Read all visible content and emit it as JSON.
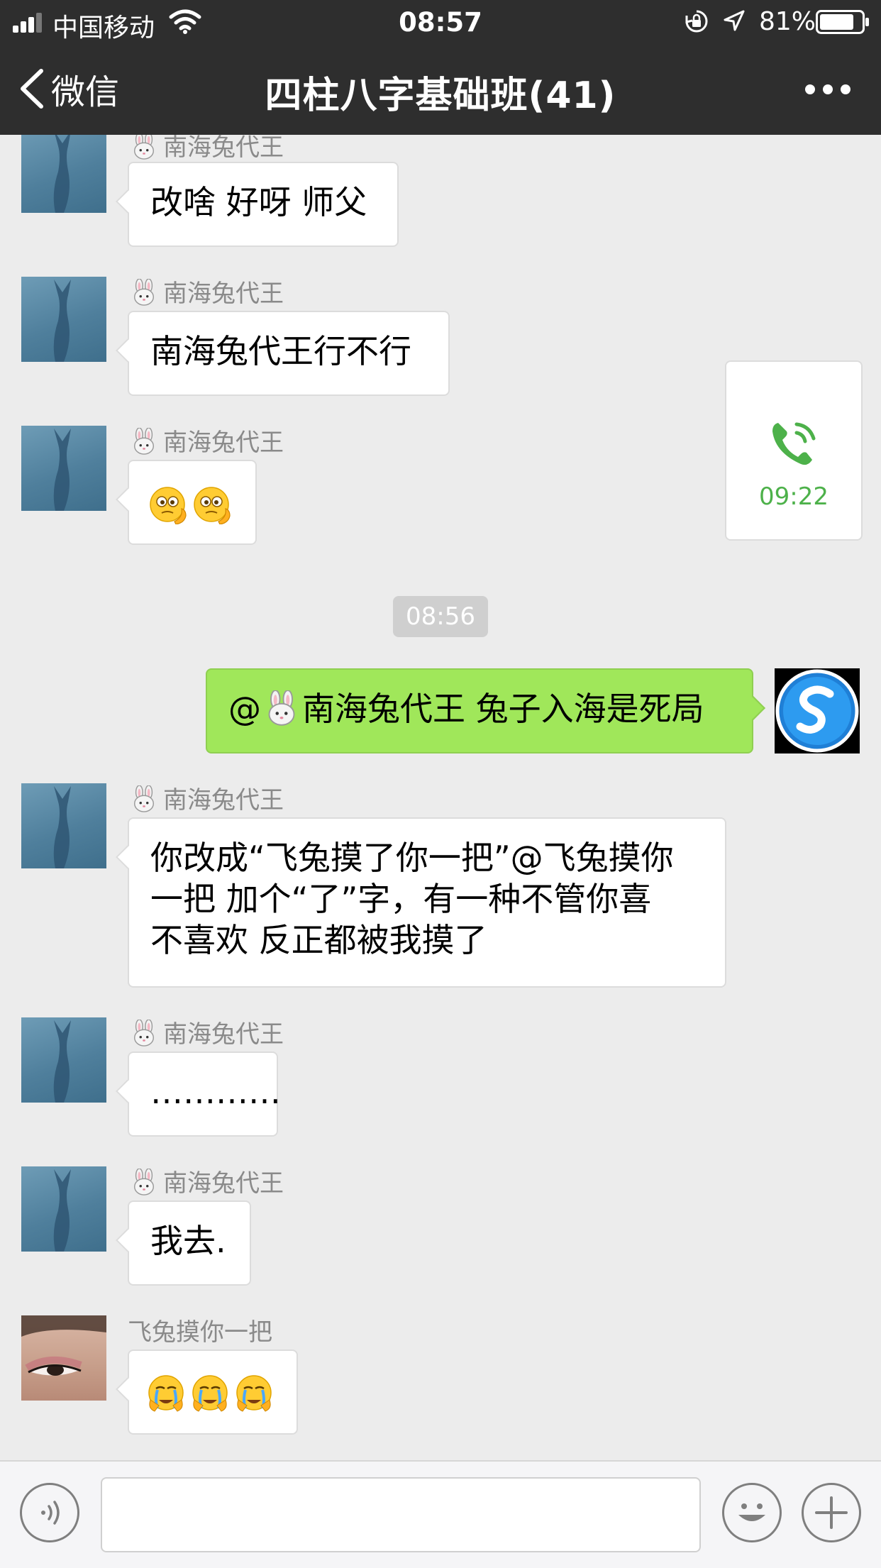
{
  "status_bar": {
    "carrier": "中国移动",
    "time": "08:57",
    "battery_percent": "81%",
    "battery_level": 0.81
  },
  "nav": {
    "back_label": "微信",
    "title": "四柱八字基础班(41)"
  },
  "messages": [
    {
      "sender": "南海兔代王",
      "text": "改啥 好呀 师父"
    },
    {
      "sender": "南海兔代王",
      "text": "南海兔代王行不行"
    },
    {
      "sender": "南海兔代王",
      "emoji": "peeking-face-emoji",
      "count": 2
    },
    {
      "sender": "南海兔代王",
      "text_lines": [
        "你改成“飞兔摸了你一把”@飞兔摸你",
        "一把 加个“了”字，有一种不管你喜",
        "不喜欢 反正都被我摸了"
      ]
    },
    {
      "sender": "南海兔代王",
      "text": "…………"
    },
    {
      "sender": "南海兔代王",
      "text": "我去."
    },
    {
      "sender": "飞兔摸你一把",
      "emoji": "crying-face-emoji",
      "count": 3
    }
  ],
  "call_card": {
    "icon": "phone-call-icon",
    "duration": "09:22"
  },
  "timestamp": "08:56",
  "own_message": {
    "prefix": "@",
    "mention": "南海兔代王",
    "text": "兔子入海是死局"
  },
  "input_bar": {
    "voice_icon": "voice-input-icon",
    "emoji_icon": "emoji-icon",
    "plus_icon": "plus-icon",
    "value": ""
  },
  "colors": {
    "header_bg": "#2e2e2e",
    "chat_bg": "#ececec",
    "own_bubble": "#a0e75a",
    "call_green": "#4db14a"
  }
}
